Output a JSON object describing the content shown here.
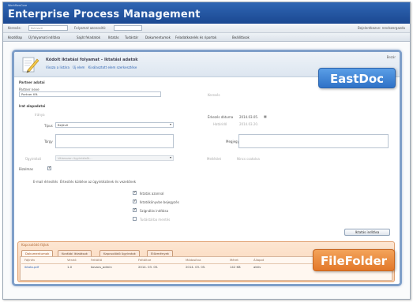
{
  "app": {
    "subtitle": "WorkflowCore",
    "title": "Enterprise Process Management"
  },
  "toolbar": {
    "search_label": "Keresés:",
    "search_placeholder": "Kulcsszó",
    "process_label": "Folyamat azonosító:",
    "process_value": "",
    "user_text": "Bejelentkezve: rendszergazda"
  },
  "menu": {
    "items": [
      "Kezdőlap",
      "Új folyamat indítása",
      "Saját feladatok",
      "Iktatás",
      "Tudástár",
      "Dokumentumok",
      "Feladatkezelés és riportok",
      "Beállítások"
    ]
  },
  "panel": {
    "title": "Kódolt iktatási folyamat – Iktatási adatok",
    "links": [
      "Vissza a listára",
      "Új elem",
      "Kiválasztott elem szerkesztése"
    ],
    "close_text": "Bezár"
  },
  "badges": {
    "east": "EastDoc",
    "file": "FileFolder"
  },
  "form": {
    "section_partner": "Partner adatai",
    "partner_field_label": "Partner neve",
    "partner_value": "Partner Kft.",
    "partner_hint": "Keresés",
    "section_document": "Irat alapadatai",
    "direction_label": "Iránya",
    "type_label": "Típus",
    "type_value": "Bejövő",
    "subject_label": "Tárgy",
    "received_label": "Érkezés dátuma",
    "received_value": "2014.03.05.",
    "deadline_label": "Határidő",
    "deadline_value": "2014.03.20.",
    "note_label": "Megjegyzés",
    "handler_label": "Ügyintéző",
    "handler_value": "Válasszon ügyintézőt...",
    "attachment_label": "Melléklet",
    "attachment_value": "Nincs csatolva",
    "confidential_label": "Bizalmas",
    "confidential_checked": true,
    "notify_label": "E-mail értesítés",
    "notify_text": "Értesítés küldése az ügyintézőnek és vezetőnek",
    "options": [
      {
        "label": "Iktatás azonnal",
        "checked": true
      },
      {
        "label": "Iktatókönyvbe bejegyzés",
        "checked": true
      },
      {
        "label": "Szignálás indítása",
        "checked": true
      },
      {
        "label": "Tudástárba mentés",
        "checked": false
      }
    ],
    "submit_label": "Iktatás indítása"
  },
  "files": {
    "title": "Kapcsolódó fájlok",
    "tabs": [
      "Dokumentumok",
      "Korábbi iktatások",
      "Kapcsolódó ügyiratok",
      "Előzmények"
    ],
    "columns": [
      "Fájlnév",
      "Verzió",
      "Feltöltő",
      "Feltöltve",
      "Módosítva",
      "Méret",
      "Állapot",
      ""
    ],
    "rows": [
      [
        "iktato.pdf",
        "1.0",
        "kovacs_admin",
        "2014. 03. 05.",
        "2014. 03. 05.",
        "142 KB",
        "aktív",
        "Letöltés"
      ]
    ]
  }
}
